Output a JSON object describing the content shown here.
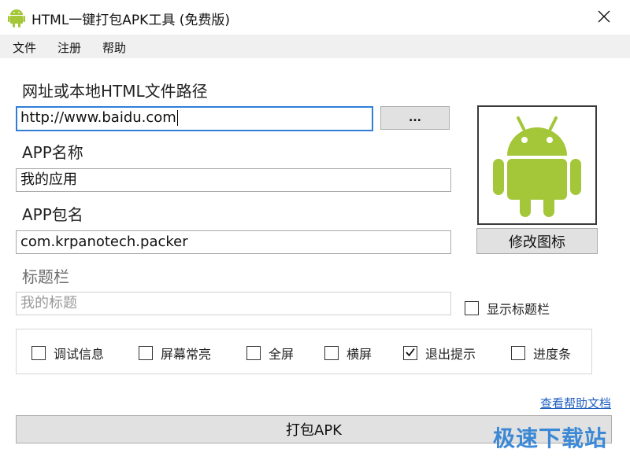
{
  "window": {
    "title": "HTML一键打包APK工具 (免费版)"
  },
  "menu": [
    "文件",
    "注册",
    "帮助"
  ],
  "url_field": {
    "label": "网址或本地HTML文件路径",
    "value": "http://www.baidu.com",
    "browse_label": "..."
  },
  "app_name": {
    "label": "APP名称",
    "value": "我的应用"
  },
  "package_name": {
    "label": "APP包名",
    "value": "com.krpanotech.packer"
  },
  "title_bar": {
    "label": "标题栏",
    "placeholder": "我的标题",
    "show_label": "显示标题栏",
    "show_checked": false
  },
  "icon": {
    "change_label": "修改图标",
    "android_color": "#a4c639"
  },
  "options": [
    {
      "label": "调试信息",
      "checked": false
    },
    {
      "label": "屏幕常亮",
      "checked": false
    },
    {
      "label": "全屏",
      "checked": false
    },
    {
      "label": "横屏",
      "checked": false
    },
    {
      "label": "退出提示",
      "checked": true
    },
    {
      "label": "进度条",
      "checked": false
    }
  ],
  "help_link": "查看帮助文档",
  "pack_button": "打包APK",
  "watermark": "极速下载站"
}
